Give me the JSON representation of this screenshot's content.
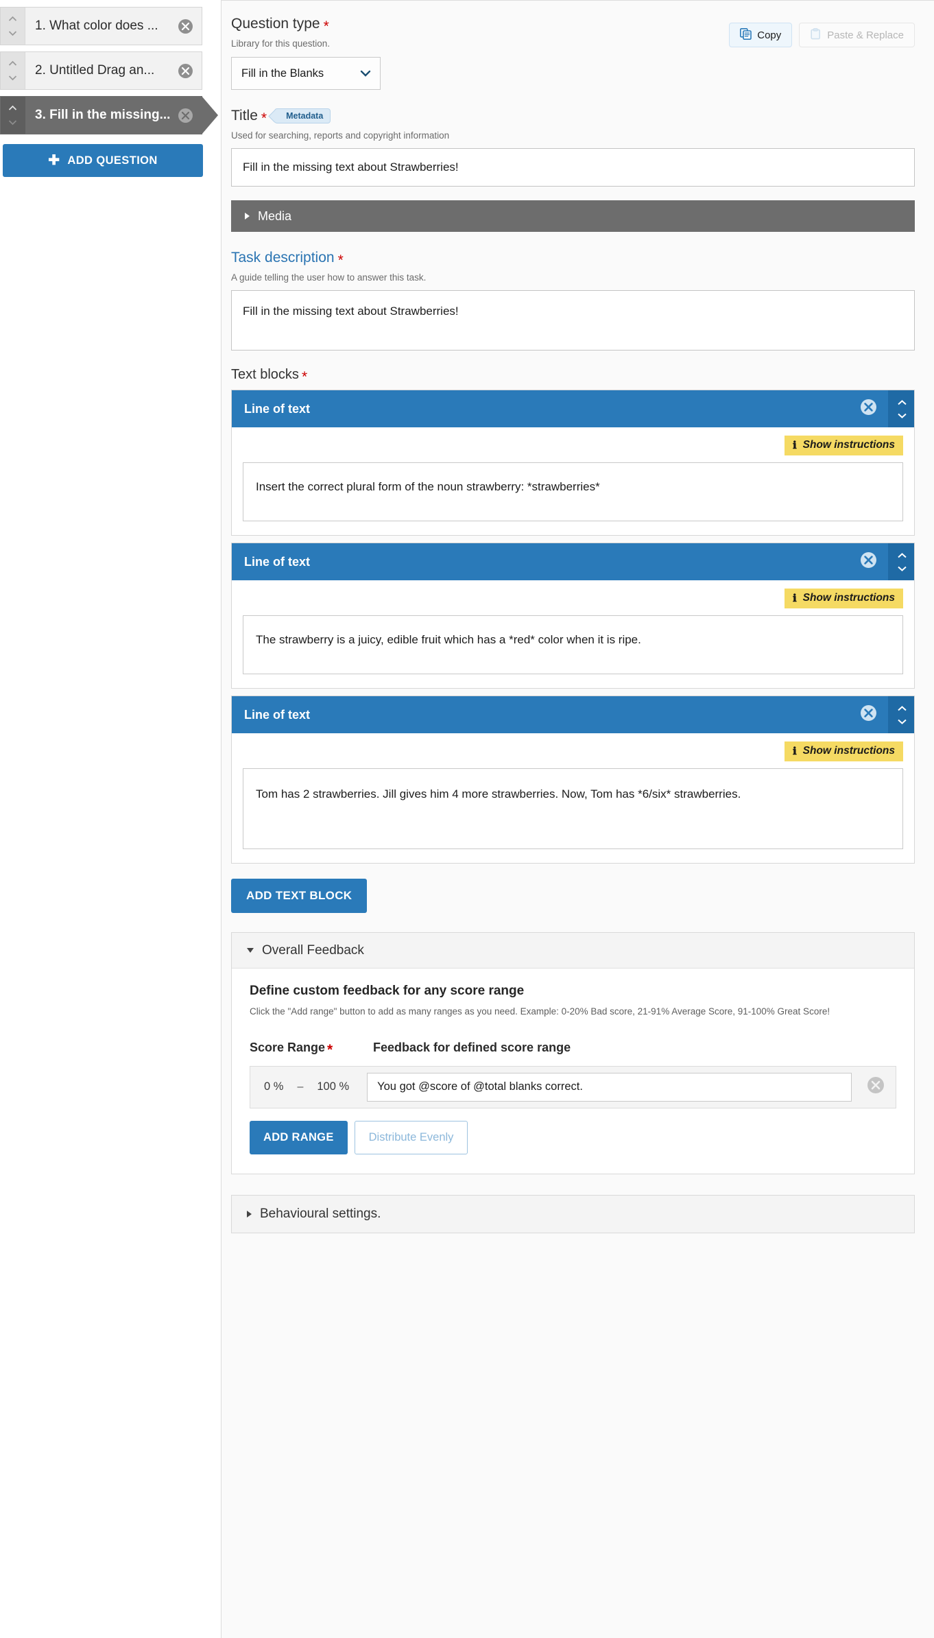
{
  "sidebar": {
    "questions": [
      {
        "label": "1. What color does ...",
        "active": false
      },
      {
        "label": "2. Untitled Drag an...",
        "active": false
      },
      {
        "label": "3. Fill in the missing...",
        "active": true
      }
    ],
    "add_question_label": "ADD QUESTION",
    "add_question_icon": "plus-icon"
  },
  "question_type": {
    "heading": "Question type",
    "required_mark": "*",
    "hint": "Library for this question.",
    "selected": "Fill in the Blanks",
    "chevron_icon": "chevron-down-icon",
    "copy_label": "Copy",
    "copy_icon": "copy-icon",
    "paste_label": "Paste & Replace",
    "paste_icon": "clipboard-icon"
  },
  "title": {
    "heading": "Title",
    "required_mark": "*",
    "badge": "Metadata",
    "hint": "Used for searching, reports and copyright information",
    "value": "Fill in the missing text about Strawberries!"
  },
  "media": {
    "label": "Media",
    "toggle_icon": "triangle-right-icon"
  },
  "task_description": {
    "heading": "Task description",
    "required_mark": "*",
    "hint": "A guide telling the user how to answer this task.",
    "value": "Fill in the missing text about Strawberries!"
  },
  "text_blocks": {
    "heading": "Text blocks",
    "required_mark": "*",
    "add_button": "ADD TEXT BLOCK",
    "blocks": [
      {
        "title": "Line of text",
        "remove_icon": "remove-circle-icon",
        "instructions_label": "Show instructions",
        "instructions_icon": "info-icon",
        "text": "Insert the correct plural form of the noun strawberry: *strawberries*"
      },
      {
        "title": "Line of text",
        "remove_icon": "remove-circle-icon",
        "instructions_label": "Show instructions",
        "instructions_icon": "info-icon",
        "text": "The strawberry is a juicy, edible fruit which has a *red* color when it is ripe."
      },
      {
        "title": "Line of text",
        "remove_icon": "remove-circle-icon",
        "instructions_label": "Show instructions",
        "instructions_icon": "info-icon",
        "text": "Tom has 2 strawberries. Jill gives him 4 more strawberries. Now, Tom has *6/six* strawberries."
      }
    ]
  },
  "overall_feedback": {
    "panel_title": "Overall Feedback",
    "toggle_icon": "triangle-down-icon",
    "heading": "Define custom feedback for any score range",
    "description": "Click the \"Add range\" button to add as many ranges as you need. Example: 0-20% Bad score, 21-91% Average Score, 91-100% Great Score!",
    "col_score_range": "Score Range",
    "col_required_mark": "*",
    "col_feedback": "Feedback for defined score range",
    "ranges": [
      {
        "min": "0 %",
        "separator": "–",
        "max": "100 %",
        "feedback": "You got @score of @total blanks correct.",
        "remove_icon": "remove-circle-icon"
      }
    ],
    "add_range_label": "ADD RANGE",
    "distribute_label": "Distribute Evenly"
  },
  "behavioural_settings": {
    "label": "Behavioural settings.",
    "toggle_icon": "triangle-right-icon"
  },
  "colors": {
    "accent": "#2a7ab9",
    "required": "#cc0000",
    "instructions": "#f5da63",
    "media_bar": "#6d6d6d"
  }
}
